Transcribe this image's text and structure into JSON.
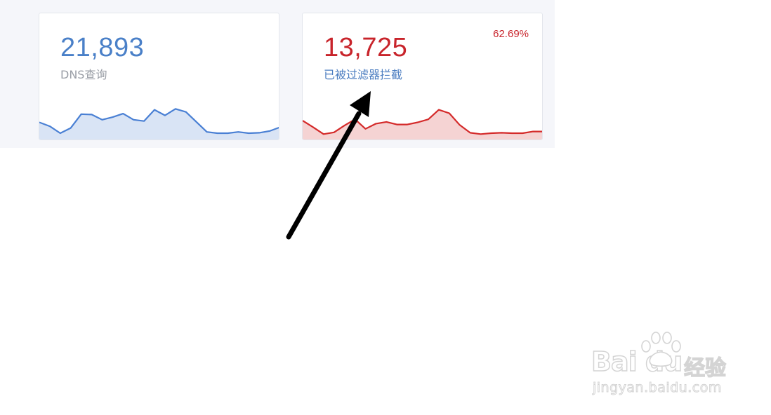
{
  "cards": [
    {
      "value": "21,893",
      "label": "DNS查询",
      "value_color": "#4a80c8",
      "label_color": "#9a9ea6",
      "line_color": "#4a80d4",
      "fill_color": "#d9e4f5",
      "series": [
        33,
        24,
        8,
        20,
        52,
        51,
        39,
        45,
        53,
        39,
        36,
        62,
        49,
        64,
        57,
        34,
        11,
        8,
        8,
        11,
        8,
        9,
        13,
        22
      ]
    },
    {
      "value": "13,725",
      "label": "已被过滤器拦截",
      "percent": "62.69%",
      "value_color": "#c8242b",
      "label_color": "#4a7cc0",
      "percent_color": "#c8242b",
      "line_color": "#d42a2a",
      "fill_color": "#f5d3d3",
      "series": [
        37,
        22,
        6,
        10,
        26,
        40,
        18,
        30,
        34,
        28,
        28,
        33,
        40,
        62,
        54,
        27,
        9,
        6,
        8,
        9,
        8,
        8,
        12,
        12
      ]
    }
  ],
  "watermark": {
    "brand": "Bai du",
    "product": "经验",
    "url": "jingyan.baidu.com"
  }
}
